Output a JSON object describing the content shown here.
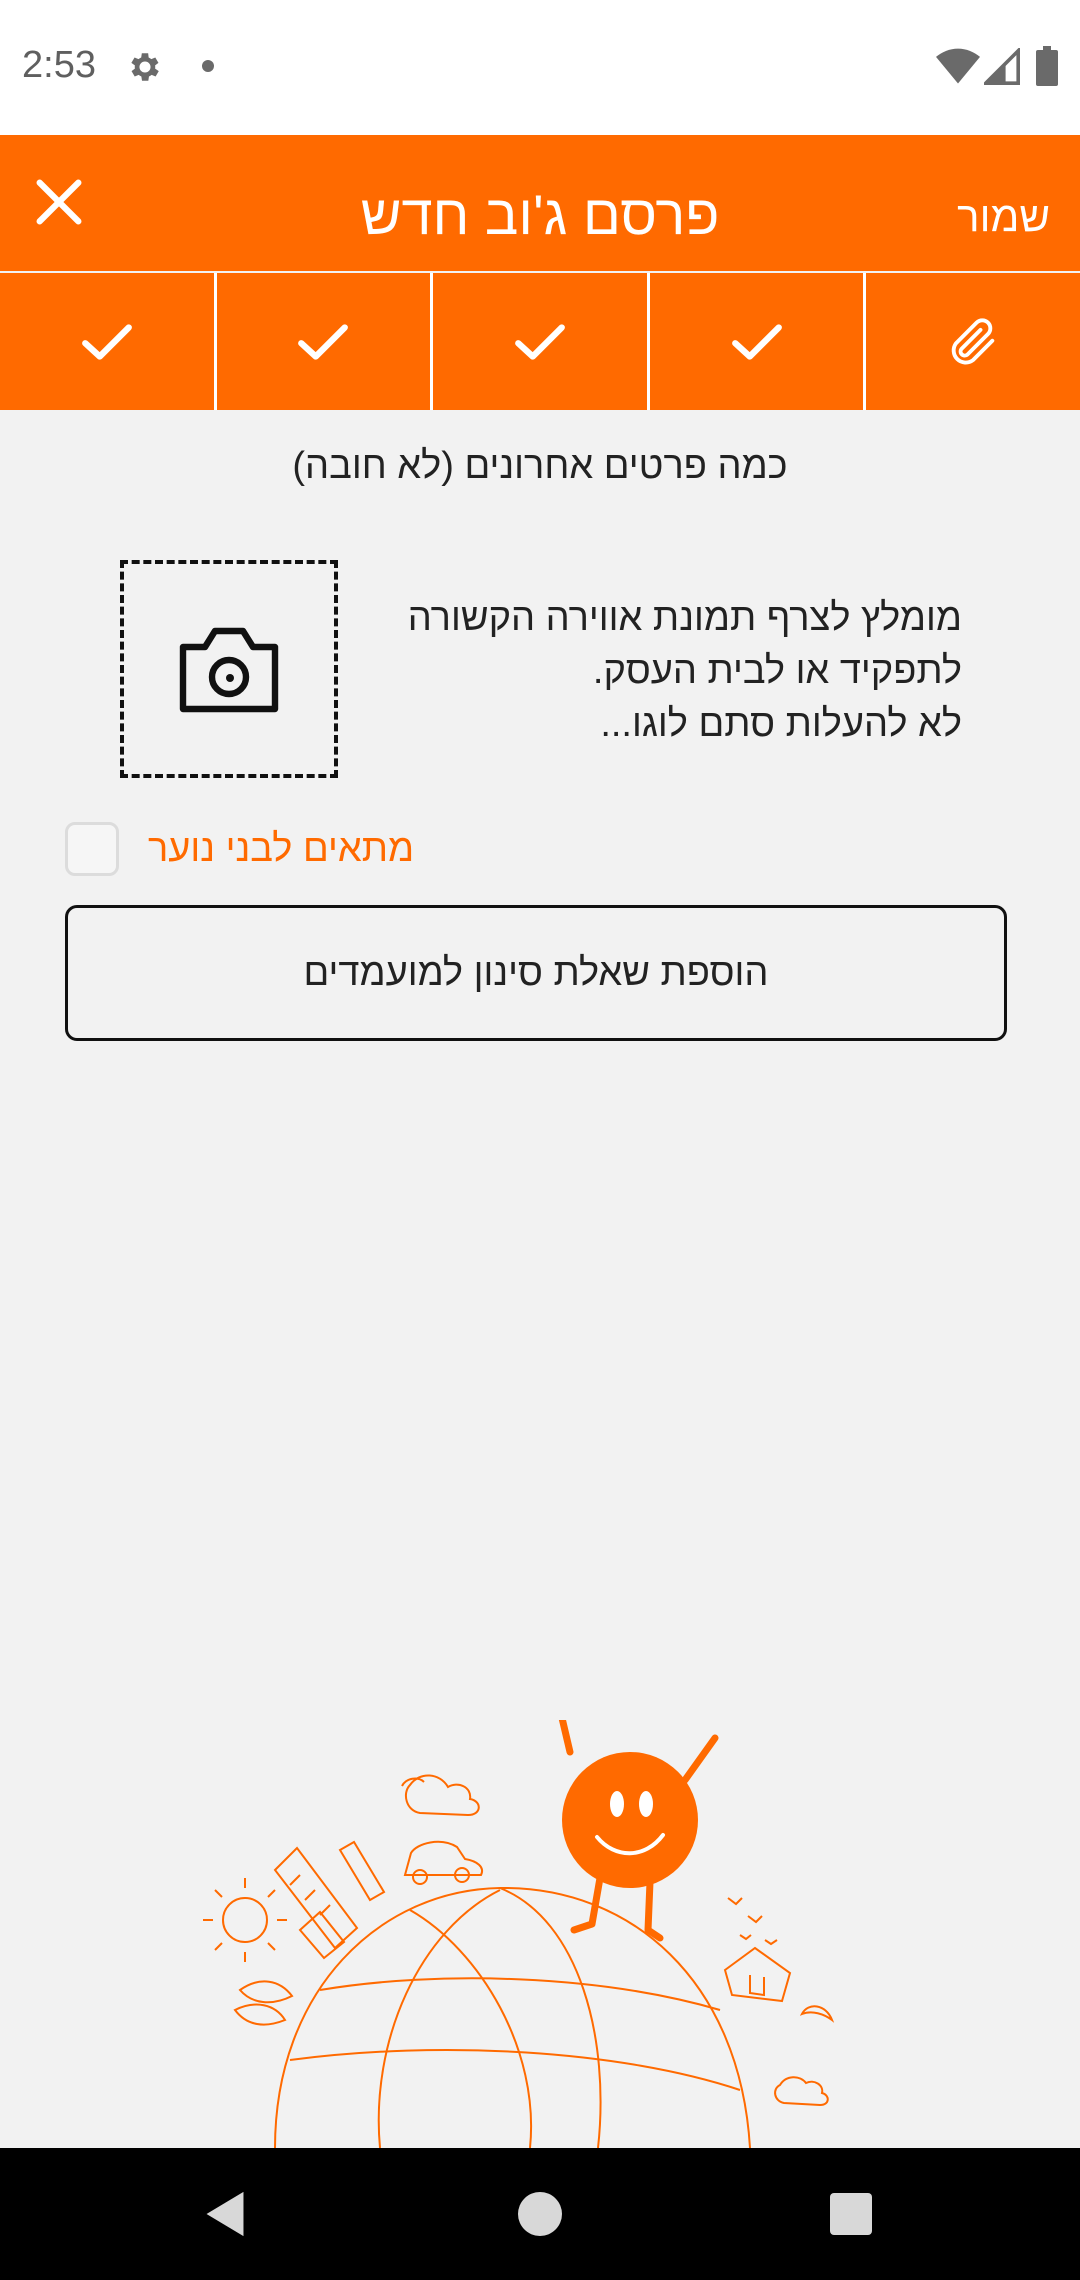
{
  "status_bar": {
    "time": "2:53",
    "icons": [
      "gear-icon",
      "dot-icon",
      "wifi-icon",
      "signal-icon",
      "battery-icon"
    ]
  },
  "header": {
    "title": "פרסם ג'וב חדש",
    "save_label": "שמור",
    "close_icon": "close-icon",
    "background_color": "#ff6a00"
  },
  "steps": {
    "items": [
      {
        "icon": "check-icon",
        "state": "done"
      },
      {
        "icon": "check-icon",
        "state": "done"
      },
      {
        "icon": "check-icon",
        "state": "done"
      },
      {
        "icon": "check-icon",
        "state": "done"
      },
      {
        "icon": "paperclip-icon",
        "state": "current"
      }
    ]
  },
  "content": {
    "section_title": "כמה פרטים אחרונים (לא חובה)",
    "photo_hint_lines": [
      "מומלץ לצרף תמונת אווירה הקשורה",
      "לתפקיד או לבית העסק.",
      "לא להעלות סתם לוגו..."
    ],
    "photo_icon": "camera-icon",
    "teen_label": "מתאים לבני נוער",
    "teen_checked": false,
    "filter_button_label": "הוספת שאלת סינון למועמדים"
  },
  "colors": {
    "accent": "#ff6a00",
    "background": "#f2f2f2"
  }
}
